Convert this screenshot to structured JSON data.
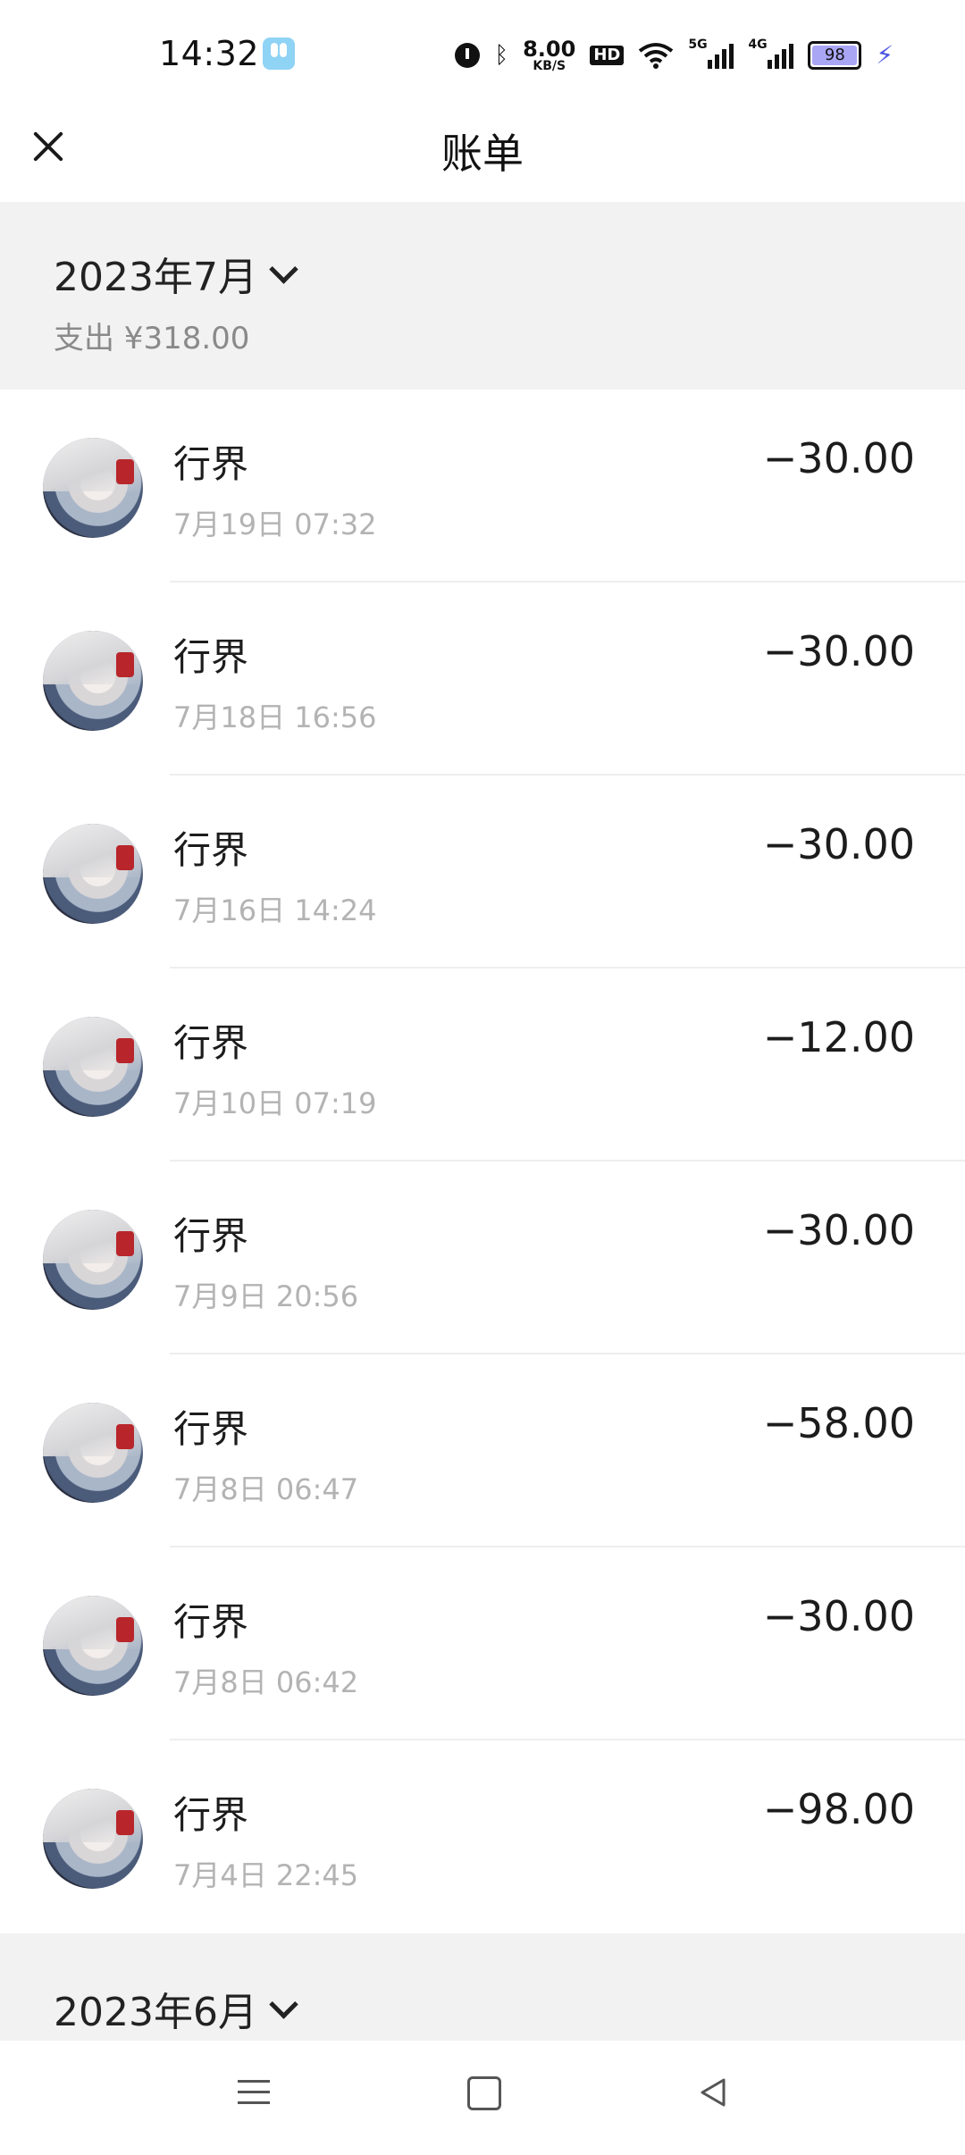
{
  "status_bar": {
    "time": "14:32",
    "net_speed": "8.00",
    "net_unit": "KB/S",
    "hd_label": "HD",
    "signal1": "5G",
    "signal2": "4G",
    "battery": "98",
    "icons": [
      "app-icon",
      "alarm-icon",
      "bluetooth-icon",
      "wifi-icon",
      "signal-icon",
      "battery-icon",
      "charging-icon"
    ]
  },
  "header": {
    "title": "账单"
  },
  "month_sections": [
    {
      "month": "2023年7月",
      "expense": "支出 ¥318.00"
    },
    {
      "month": "2023年6月"
    }
  ],
  "transactions": [
    {
      "name": "行界",
      "time": "7月19日 07:32",
      "amount": "−30.00"
    },
    {
      "name": "行界",
      "time": "7月18日 16:56",
      "amount": "−30.00"
    },
    {
      "name": "行界",
      "time": "7月16日 14:24",
      "amount": "−30.00"
    },
    {
      "name": "行界",
      "time": "7月10日 07:19",
      "amount": "−12.00"
    },
    {
      "name": "行界",
      "time": "7月9日 20:56",
      "amount": "−30.00"
    },
    {
      "name": "行界",
      "time": "7月8日 06:47",
      "amount": "−58.00"
    },
    {
      "name": "行界",
      "time": "7月8日 06:42",
      "amount": "−30.00"
    },
    {
      "name": "行界",
      "time": "7月4日 22:45",
      "amount": "−98.00"
    }
  ]
}
